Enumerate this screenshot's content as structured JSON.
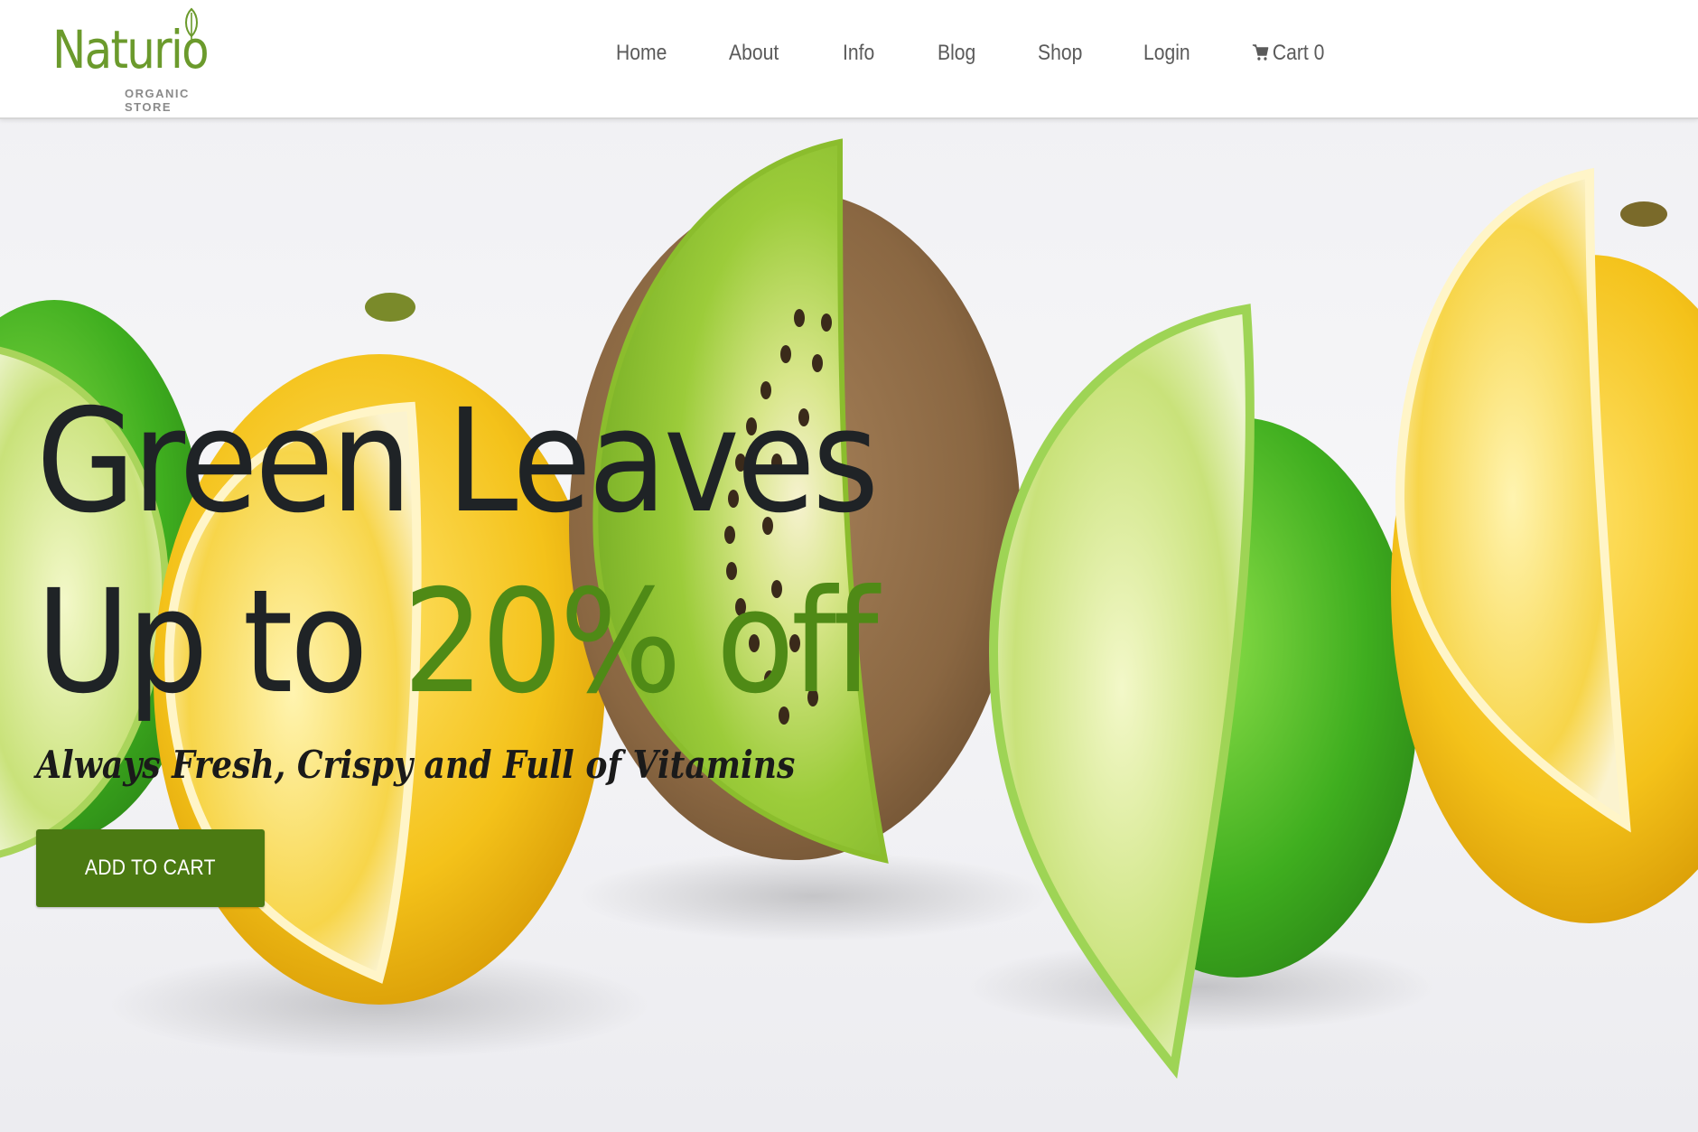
{
  "brand": {
    "name": "Naturio",
    "tagline": "ORGANIC STORE"
  },
  "nav": {
    "items": [
      "Home",
      "About",
      "Info",
      "Blog",
      "Shop",
      "Login"
    ],
    "cart_label": "Cart 0"
  },
  "hero": {
    "headline_line1": "Green Leaves",
    "headline_prefix": "Up to ",
    "headline_accent": "20% off",
    "subtitle": "Always Fresh, Crispy and Full of Vitamins",
    "cta_label": "ADD TO CART"
  },
  "colors": {
    "brand_green": "#6b9a2c",
    "accent_green": "#4f8a16",
    "button_green": "#4b7a12",
    "nav_text": "#5a5a5a",
    "headline_text": "#1f2326"
  },
  "icons": [
    "leaf-icon",
    "cart-icon"
  ]
}
